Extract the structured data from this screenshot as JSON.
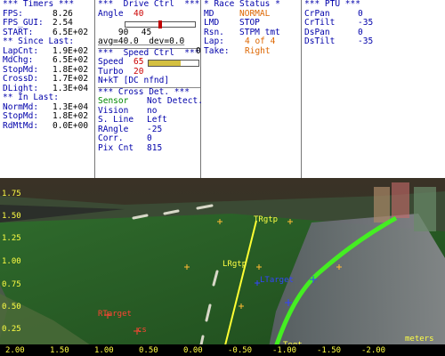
{
  "timers": {
    "header": "*** Timers ***",
    "rows": [
      {
        "k": "FPS:",
        "v": "8.26"
      },
      {
        "k": "FPS_GUI:",
        "v": "2.54"
      },
      {
        "k": "START:",
        "v": "6.5E+02"
      }
    ],
    "since_header": "** Since Last:",
    "since": [
      {
        "k": "LapCnt:",
        "v": "1.9E+02"
      },
      {
        "k": "MdChg:",
        "v": "6.5E+02"
      },
      {
        "k": "StopMd:",
        "v": "1.8E+02"
      },
      {
        "k": "CrossD:",
        "v": "1.7E+02"
      },
      {
        "k": "DLight:",
        "v": "1.3E+04"
      }
    ],
    "in_header": "** In Last:",
    "in_last": [
      {
        "k": "NormMd:",
        "v": "1.3E+04"
      },
      {
        "k": "StopMd:",
        "v": "1.8E+02"
      },
      {
        "k": "RdMtMd:",
        "v": "0.0E+00"
      }
    ]
  },
  "drive": {
    "header": "***  Drive Ctrl  ***",
    "angle_label": "Angle",
    "angle_value": "40",
    "slider_min": "90",
    "slider_max": "0",
    "slider_fraction": 0.5,
    "slider_value": "45",
    "avg_dev": "avg=40.0  dev=0.0"
  },
  "speed": {
    "header": "***  Speed Ctrl  ***",
    "speed_label": "Speed",
    "speed_value": "65",
    "speed_fraction": 0.65,
    "turbo_label": "Turbo",
    "turbo_value": "20",
    "nkt": "N+kT [DC nfnd]"
  },
  "cross": {
    "header": "*** Cross Det. ***",
    "rows": [
      {
        "k": "Sensor",
        "v": "Not Detect."
      },
      {
        "k": "Vision",
        "v": "no"
      },
      {
        "k": "S. Line",
        "v": "Left"
      },
      {
        "k": "RAngle",
        "v": "-25"
      },
      {
        "k": "Corr.",
        "v": "0"
      },
      {
        "k": "Pix Cnt",
        "v": "815"
      }
    ]
  },
  "race": {
    "header": "* Race Status *",
    "rows": [
      {
        "k": "MD",
        "v": "NORMAL"
      },
      {
        "k": "LMD",
        "v": "STOP"
      },
      {
        "k": "Rsn.",
        "v": "STPM tmt"
      },
      {
        "k": "Lap:",
        "v": "4 of 4"
      },
      {
        "k": "Take:",
        "v": "Right"
      }
    ]
  },
  "ptu": {
    "header": "*** PTU ***",
    "rows": [
      {
        "k": "CrPan",
        "v": "0"
      },
      {
        "k": "CrTilt",
        "v": "-35"
      },
      {
        "k": "DsPan",
        "v": "0"
      },
      {
        "k": "DsTilt",
        "v": "-35"
      }
    ]
  },
  "camera": {
    "y_ticks": [
      "1.75",
      "1.50",
      "1.25",
      "1.00",
      "0.75",
      "0.50",
      "0.25"
    ],
    "x_ticks": [
      "2.00",
      "1.50",
      "1.00",
      "0.50",
      "0.00",
      "-0.50",
      "-1.00",
      "-1.50",
      "-2.00"
    ],
    "units": "meters",
    "labels": {
      "trgtp": "TRgtp",
      "lrgtp": "LRgtp",
      "ltarget": "LTarget",
      "rtarget": "RTarget",
      "cs": "cs",
      "sensor": "Tegt"
    }
  }
}
